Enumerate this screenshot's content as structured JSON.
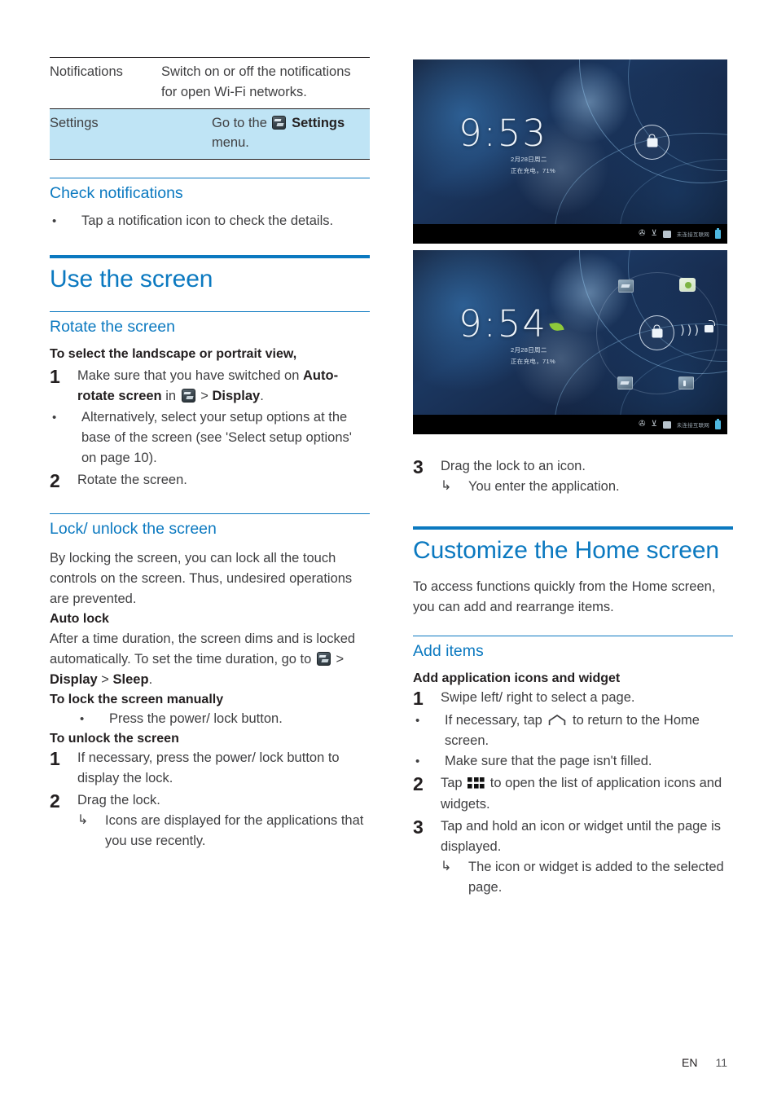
{
  "meta": {
    "language_code": "EN",
    "page_number": "11"
  },
  "colors": {
    "heading_blue": "#0b79c0",
    "row_highlight": "#bfe4f5",
    "body_text": "#3f3f41"
  },
  "left_column": {
    "table": {
      "rows": [
        {
          "key": "Notifications",
          "value": "Switch on or off the notifications for open Wi-Fi networks.",
          "highlighted": false
        },
        {
          "key": "Settings",
          "value_prefix": "Go to the",
          "value_icon": "settings-icon",
          "value_bold": "Settings",
          "value_suffix": "menu.",
          "highlighted": true
        }
      ]
    },
    "check_notifications": {
      "heading": "Check notifications",
      "bullets": [
        "Tap a notification icon to check the details."
      ]
    },
    "use_the_screen": {
      "heading": "Use the screen"
    },
    "rotate_the_screen": {
      "heading": "Rotate the screen",
      "intro": "To select the landscape or portrait view,",
      "step1_num": "1",
      "step1_a": "Make sure that you have switched on",
      "step1_bold1": "Auto-rotate screen",
      "step1_in": "in",
      "step1_icon": "settings-icon",
      "step1_gt": ">",
      "step1_bold2": "Display",
      "step1_dot": ".",
      "step1_bullet": "Alternatively, select your setup options at the base of the screen (see 'Select setup options' on page 10).",
      "step2_num": "2",
      "step2": "Rotate the screen."
    },
    "lock_unlock": {
      "heading": "Lock/ unlock the screen",
      "intro": "By locking the screen, you can lock all the touch controls on the screen. Thus, undesired operations are prevented.",
      "auto_lock_heading": "Auto lock",
      "auto_lock_a": "After a time duration, the screen dims and is locked automatically. To set the time duration, go to",
      "auto_lock_icon": "settings-icon",
      "auto_lock_gt1": ">",
      "auto_lock_bold1": "Display",
      "auto_lock_gt2": ">",
      "auto_lock_bold2": "Sleep",
      "auto_lock_dot": ".",
      "manual_heading": "To lock the screen manually",
      "manual_bullet": "Press the power/ lock button.",
      "unlock_heading": "To unlock the screen",
      "unlock_step1_num": "1",
      "unlock_step1": "If necessary, press the power/ lock button to display the lock.",
      "unlock_step2_num": "2",
      "unlock_step2": "Drag the lock.",
      "unlock_step2_result": "Icons are displayed for the applications that you use recently."
    }
  },
  "right_column": {
    "figures": [
      {
        "name": "lock-screen-locked",
        "clock": "9:53",
        "date": "2月28日周二",
        "battery": "正在充电，71%",
        "status_text": "未连接互联网",
        "lock_state": "locked"
      },
      {
        "name": "lock-screen-dragging",
        "clock": "9:54",
        "date": "2月28日周二",
        "battery": "正在充电，71%",
        "status_text": "未连接互联网",
        "lock_state": "dragging"
      }
    ],
    "step3": {
      "num": "3",
      "text": "Drag the lock to an icon.",
      "result": "You enter the application."
    },
    "customize_home": {
      "heading": "Customize the Home screen",
      "intro": "To access functions quickly from the Home screen, you can add and rearrange items."
    },
    "add_items": {
      "heading": "Add items",
      "sub_heading": "Add application icons and widget",
      "step1_num": "1",
      "step1": "Swipe left/ right to select a page.",
      "step1_b1_a": "If necessary, tap",
      "step1_b1_icon": "home-icon",
      "step1_b1_b": "to return to the Home screen.",
      "step1_b2": "Make sure that the page isn't filled.",
      "step2_num": "2",
      "step2_a": "Tap",
      "step2_icon": "apps-grid-icon",
      "step2_b": "to open the list of application icons and widgets.",
      "step3_num": "3",
      "step3": "Tap and hold an icon or widget until the page is displayed.",
      "step3_result": "The icon or widget is added to the selected page."
    }
  }
}
